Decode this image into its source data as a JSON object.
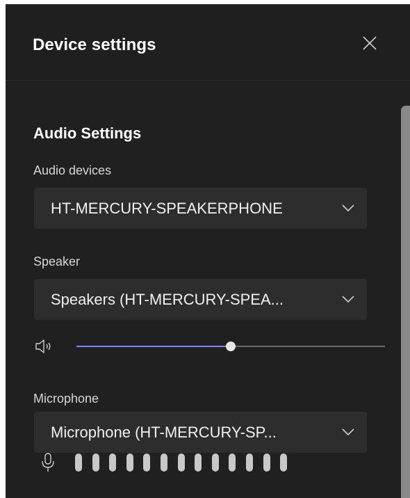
{
  "dialog": {
    "title": "Device settings",
    "close_icon": "close-icon"
  },
  "audio": {
    "section_title": "Audio Settings",
    "devices_label": "Audio devices",
    "devices_value": "HT-MERCURY-SPEAKERPHONE",
    "speaker_label": "Speaker",
    "speaker_value": "Speakers (HT-MERCURY-SPEA...",
    "speaker_volume_percent": 50,
    "microphone_label": "Microphone",
    "microphone_value": "Microphone (HT-MERCURY-SP...",
    "mic_level_bar_count": 13
  },
  "colors": {
    "background": "#1f1f1f",
    "dropdown": "#2d2d2d",
    "accent": "#7f85f5"
  }
}
